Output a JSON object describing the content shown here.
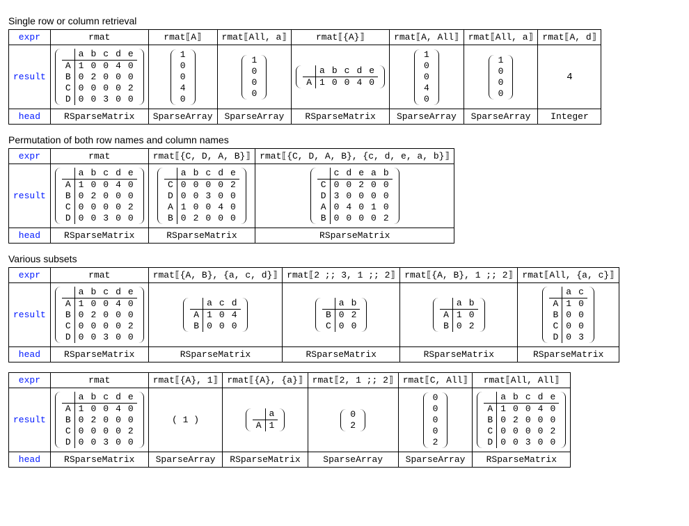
{
  "sections": [
    {
      "title": "Single row or column retrieval"
    },
    {
      "title": "Permutation of both row names and column names"
    },
    {
      "title": "Various subsets"
    }
  ],
  "labels": {
    "expr": "expr",
    "result": "result",
    "head": "head"
  },
  "heads": {
    "rsm": "RSparseMatrix",
    "sa": "SparseArray",
    "int": "Integer"
  },
  "expr": {
    "rmat": "rmat",
    "rmat_A": "rmat⟦A⟧",
    "rmat_All_a": "rmat⟦All, a⟧",
    "rmat_braceA": "rmat⟦{A}⟧",
    "rmat_A_All": "rmat⟦A, All⟧",
    "rmat_All_a2": "rmat⟦All, a⟧",
    "rmat_A_d": "rmat⟦A, d⟧",
    "rmat_cdab": "rmat⟦{C, D, A, B}⟧",
    "rmat_cdab_cdeab": "rmat⟦{C, D, A, B}, {c, d, e, a, b}⟧",
    "rmat_AB_acd": "rmat⟦{A, B}, {a, c, d}⟧",
    "rmat_span23_12": "rmat⟦2 ;; 3, 1 ;; 2⟧",
    "rmat_AB_1to2": "rmat⟦{A, B}, 1 ;; 2⟧",
    "rmat_All_ac": "rmat⟦All, {a, c}⟧",
    "rmat_A_1": "rmat⟦{A}, 1⟧",
    "rmat_A_a": "rmat⟦{A}, {a}⟧",
    "rmat_2_1to2": "rmat⟦2, 1 ;; 2⟧",
    "rmat_C_All": "rmat⟦C, All⟧",
    "rmat_All_All": "rmat⟦All, All⟧"
  },
  "base_matrix": {
    "cols": [
      "a",
      "b",
      "c",
      "d",
      "e"
    ],
    "rows": [
      "A",
      "B",
      "C",
      "D"
    ],
    "data": [
      [
        1,
        0,
        0,
        4,
        0
      ],
      [
        0,
        2,
        0,
        0,
        0
      ],
      [
        0,
        0,
        0,
        0,
        2
      ],
      [
        0,
        0,
        3,
        0,
        0
      ]
    ]
  },
  "vec_A": [
    1,
    0,
    0,
    4,
    0
  ],
  "vec_All_a": [
    1,
    0,
    0,
    0
  ],
  "scalar_A_d": "4",
  "matrix_braceA": {
    "cols": [
      "a",
      "b",
      "c",
      "d",
      "e"
    ],
    "rows": [
      "A"
    ],
    "data": [
      [
        1,
        0,
        0,
        4,
        0
      ]
    ]
  },
  "perm_cdab": {
    "cols": [
      "a",
      "b",
      "c",
      "d",
      "e"
    ],
    "rows": [
      "C",
      "D",
      "A",
      "B"
    ],
    "data": [
      [
        0,
        0,
        0,
        0,
        2
      ],
      [
        0,
        0,
        3,
        0,
        0
      ],
      [
        1,
        0,
        0,
        4,
        0
      ],
      [
        0,
        2,
        0,
        0,
        0
      ]
    ]
  },
  "perm_cdab_cdeab": {
    "cols": [
      "c",
      "d",
      "e",
      "a",
      "b"
    ],
    "rows": [
      "C",
      "D",
      "A",
      "B"
    ],
    "data": [
      [
        0,
        0,
        2,
        0,
        0
      ],
      [
        3,
        0,
        0,
        0,
        0
      ],
      [
        0,
        4,
        0,
        1,
        0
      ],
      [
        0,
        0,
        0,
        0,
        2
      ]
    ]
  },
  "sub_AB_acd": {
    "cols": [
      "a",
      "c",
      "d"
    ],
    "rows": [
      "A",
      "B"
    ],
    "data": [
      [
        1,
        0,
        4
      ],
      [
        0,
        0,
        0
      ]
    ]
  },
  "sub_23_12": {
    "cols": [
      "a",
      "b"
    ],
    "rows": [
      "B",
      "C"
    ],
    "data": [
      [
        0,
        2
      ],
      [
        0,
        0
      ]
    ]
  },
  "sub_AB_12": {
    "cols": [
      "a",
      "b"
    ],
    "rows": [
      "A",
      "B"
    ],
    "data": [
      [
        1,
        0
      ],
      [
        0,
        2
      ]
    ]
  },
  "sub_All_ac": {
    "cols": [
      "a",
      "c"
    ],
    "rows": [
      "A",
      "B",
      "C",
      "D"
    ],
    "data": [
      [
        1,
        0
      ],
      [
        0,
        0
      ],
      [
        0,
        0
      ],
      [
        0,
        3
      ]
    ]
  },
  "sub_A_a": {
    "cols": [
      "a"
    ],
    "rows": [
      "A"
    ],
    "data": [
      [
        1
      ]
    ]
  },
  "row_one": "( 1 )",
  "vec_2_1to2": [
    0,
    2
  ],
  "vec_C_All": [
    0,
    0,
    0,
    0,
    2
  ]
}
